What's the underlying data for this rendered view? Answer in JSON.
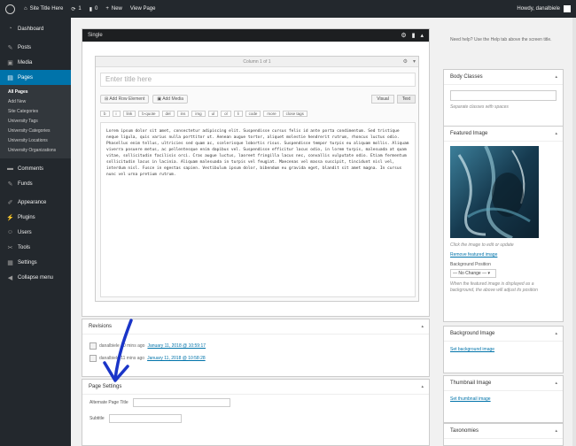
{
  "adminbar": {
    "site_title": "Site Title Here",
    "updates": "1",
    "comments": "0",
    "new_label": "New",
    "view_label": "View Page",
    "greeting": "Howdy, danalbiele"
  },
  "sidebar": {
    "items": [
      {
        "label": "Dashboard",
        "icon": "dashboard-icon"
      },
      {
        "label": "Posts",
        "icon": "pin-icon"
      },
      {
        "label": "Media",
        "icon": "media-icon"
      },
      {
        "label": "Pages",
        "icon": "pages-icon"
      },
      {
        "label": "Comments",
        "icon": "comments-icon"
      },
      {
        "label": "Funds",
        "icon": "pin-icon"
      },
      {
        "label": "Appearance",
        "icon": "brush-icon"
      },
      {
        "label": "Plugins",
        "icon": "plug-icon"
      },
      {
        "label": "Users",
        "icon": "users-icon"
      },
      {
        "label": "Tools",
        "icon": "wrench-icon"
      },
      {
        "label": "Settings",
        "icon": "settings-icon"
      },
      {
        "label": "Collapse menu",
        "icon": "collapse-icon"
      }
    ],
    "submenu": [
      "All Pages",
      "Add New",
      "Site Categories",
      "University Tags",
      "University Categories",
      "University Locations",
      "University Organizations"
    ]
  },
  "builder": {
    "title": "Single",
    "column_label": "Column 1 of 1",
    "title_placeholder": "Enter title here",
    "add_row_element": "Add Row Element",
    "add_media": "Add Media",
    "tab_visual": "Visual",
    "tab_text": "Text",
    "quicktags": [
      "b",
      "i",
      "link",
      "b-quote",
      "del",
      "ins",
      "img",
      "ul",
      "ol",
      "li",
      "code",
      "more",
      "close tags"
    ],
    "body": "Lorem ipsum dolor sit amet, consectetur adipiscing elit. Suspendisse cursus felis id ante porta condimentum. Sed tristique neque ligula, quis varius nulla porttitor ut. Aenean augue tortor, aliquet molestie hendrerit rutrum, rhoncus luctus odio. Phasellus enim tellus, ultricies sed quam ac, scelerisque lobortis risus. Suspendisse tempor turpis eu aliquam mollis. Aliquam viverra posuere metus, ac pellentesque enim dapibus vel. Suspendisse efficitur lacus odio, in lorem turpis, malesuada at quam vitae, sollicitudin facilisis orci. Cras augue luctus, laoreet fringilla lacus nec, convallis vulputate odio. Etiam fermentum sollicitudin lacus in lacinia. Aliquam malesuada in turpis vel feugiat. Maecenas vel massa suscipit, tincidunt nisl vel, interdum nisl. Fusce in egestas sapien. Vestibulum ipsum dolor, bibendum eu gravida eget, blandit sit amet magna. In cursus nunc vel urna pretium rutrum."
  },
  "revisions": {
    "title": "Revisions",
    "rows": [
      {
        "author": "danalbiele",
        "ago": "10 mins ago",
        "link": "January 11, 2018 @ 10:59:17"
      },
      {
        "author": "danalbiele",
        "ago": "11 mins ago",
        "link": "January 11, 2018 @ 10:58:28"
      }
    ]
  },
  "page_settings": {
    "title": "Page Settings",
    "alt_title_label": "Alternate Page Title",
    "subtitle_label": "Subtitle"
  },
  "right": {
    "help_text": "Need help? Use the Help tab above the screen title.",
    "body_classes_title": "Body Classes",
    "body_classes_hint": "Separate classes with spaces",
    "featured_title": "Featured Image",
    "featured_hint": "Click the image to edit or update",
    "remove_featured": "Remove featured image",
    "bg_position_label": "Background Position",
    "bg_position_value": "— No Change —",
    "featured_note": "When the featured image is displayed as a background, the above will adjust its position",
    "bg_image_title": "Background Image",
    "set_bg": "Set background image",
    "thumb_title": "Thumbnail Image",
    "set_thumb": "Set thumbnail image",
    "tax_title": "Taxonomies"
  },
  "colors": {
    "accent": "#0073aa",
    "adminbar": "#23282d",
    "annotation": "#1a35c8"
  }
}
